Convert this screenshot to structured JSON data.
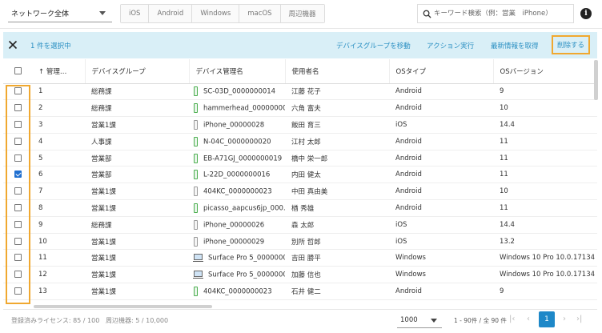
{
  "toolbar": {
    "network_select": "ネットワーク全体",
    "os_tabs": [
      "iOS",
      "Android",
      "Windows",
      "macOS",
      "周辺機器"
    ],
    "search_placeholder": "キーワード検索（例：営業　iPhone）"
  },
  "selection_bar": {
    "selected_text": "1 件を選択中",
    "actions": [
      "デバイスグループを移動",
      "アクション実行",
      "最新情報を取得"
    ],
    "delete_label": "削除する"
  },
  "table": {
    "headers": [
      "↑ 管理…",
      "デバイスグループ",
      "デバイス管理名",
      "使用者名",
      "OSタイプ",
      "OSバージョン"
    ],
    "rows": [
      {
        "num": "1",
        "group": "総務課",
        "device": "SC-03D_0000000014",
        "user": "江藤 花子",
        "os": "Android",
        "ver": "9",
        "icon": "android",
        "checked": false
      },
      {
        "num": "2",
        "group": "総務課",
        "device": "hammerhead_00000000…",
        "user": "六角 富夫",
        "os": "Android",
        "ver": "10",
        "icon": "android",
        "checked": false
      },
      {
        "num": "3",
        "group": "営業1課",
        "device": "iPhone_00000028",
        "user": "飯田 育三",
        "os": "iOS",
        "ver": "14.4",
        "icon": "ios",
        "checked": false
      },
      {
        "num": "4",
        "group": "人事課",
        "device": "N-04C_0000000020",
        "user": "江村 太郎",
        "os": "Android",
        "ver": "11",
        "icon": "android",
        "checked": false
      },
      {
        "num": "5",
        "group": "営業部",
        "device": "EB-A71GJ_0000000019",
        "user": "橋中 栄一郎",
        "os": "Android",
        "ver": "11",
        "icon": "android",
        "checked": false
      },
      {
        "num": "6",
        "group": "営業部",
        "device": "L-22D_0000000016",
        "user": "内田 健太",
        "os": "Android",
        "ver": "11",
        "icon": "android",
        "checked": true
      },
      {
        "num": "7",
        "group": "営業1課",
        "device": "404KC_0000000023",
        "user": "中田 真由美",
        "os": "Android",
        "ver": "10",
        "icon": "ios",
        "checked": false
      },
      {
        "num": "8",
        "group": "営業1課",
        "device": "picasso_aapcus6jp_000…",
        "user": "楢 秀雄",
        "os": "Android",
        "ver": "11",
        "icon": "android",
        "checked": false
      },
      {
        "num": "9",
        "group": "総務課",
        "device": "iPhone_00000026",
        "user": "森 太郎",
        "os": "iOS",
        "ver": "14.4",
        "icon": "ios",
        "checked": false
      },
      {
        "num": "10",
        "group": "営業1課",
        "device": "iPhone_00000029",
        "user": "別所 哲郎",
        "os": "iOS",
        "ver": "13.2",
        "icon": "ios",
        "checked": false
      },
      {
        "num": "11",
        "group": "営業1課",
        "device": "Surface Pro 5_0000000…",
        "user": "吉田 勝平",
        "os": "Windows",
        "ver": "Windows 10 Pro 10.0.17134",
        "icon": "win",
        "checked": false
      },
      {
        "num": "12",
        "group": "営業1課",
        "device": "Surface Pro 5_0000000…",
        "user": "加藤 信也",
        "os": "Windows",
        "ver": "Windows 10 Pro 10.0.17134",
        "icon": "win",
        "checked": false
      },
      {
        "num": "13",
        "group": "営業1課",
        "device": "404KC_0000000023",
        "user": "石井 健二",
        "os": "Android",
        "ver": "9",
        "icon": "android",
        "checked": false
      }
    ]
  },
  "footer": {
    "license": "登録済みライセンス: 85 / 100",
    "peripheral": "周辺機器: 5 / 10,000",
    "per_page": "1000",
    "range": "1 - 90件 / 全 90 件",
    "page": "1"
  }
}
